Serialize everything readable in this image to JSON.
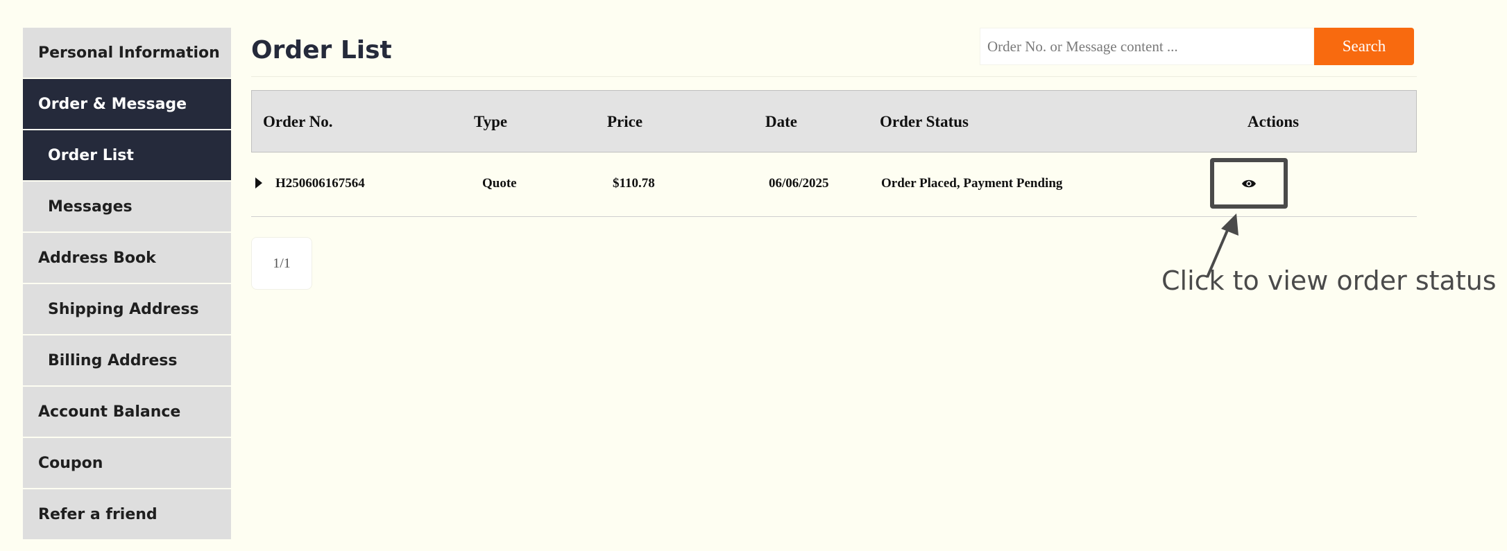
{
  "sidebar": {
    "items": [
      {
        "label": "Personal Information"
      },
      {
        "label": "Order & Message"
      },
      {
        "label": "Order List"
      },
      {
        "label": "Messages"
      },
      {
        "label": "Address Book"
      },
      {
        "label": "Shipping Address"
      },
      {
        "label": "Billing Address"
      },
      {
        "label": "Account Balance"
      },
      {
        "label": "Coupon"
      },
      {
        "label": "Refer a friend"
      }
    ]
  },
  "main": {
    "title": "Order List",
    "search": {
      "placeholder": "Order No. or Message content ...",
      "button_label": "Search"
    },
    "table": {
      "columns": [
        "Order No.",
        "Type",
        "Price",
        "Date",
        "Order Status",
        "Actions"
      ],
      "rows": [
        {
          "order_no": "H250606167564",
          "type": "Quote",
          "price": "$110.78",
          "date": "06/06/2025",
          "status": "Order Placed, Payment Pending",
          "action_icon": "eye-icon"
        }
      ]
    },
    "pagination": {
      "label": "1/1"
    }
  },
  "annotation": {
    "text": "Click to view order status"
  },
  "colors": {
    "accent": "#f86a0f",
    "sidebar_active": "#252a3b",
    "background": "#fefef2"
  }
}
